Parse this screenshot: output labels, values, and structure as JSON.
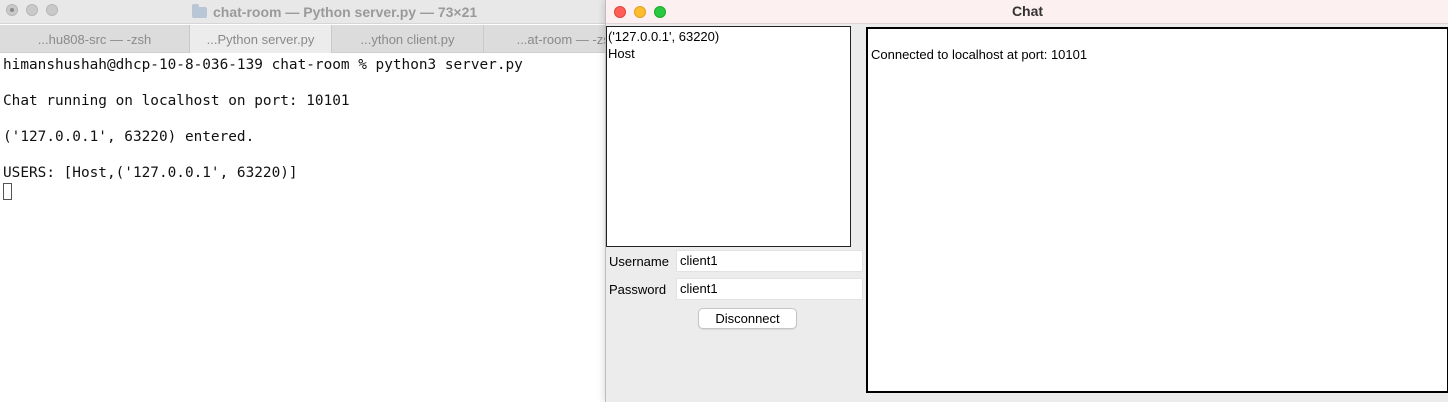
{
  "terminal": {
    "title": "chat-room — Python server.py — 73×21",
    "tabs": [
      {
        "label": "...hu808-src — -zsh",
        "active": false
      },
      {
        "label": "...Python server.py",
        "active": true
      },
      {
        "label": "...ython client.py",
        "active": false
      },
      {
        "label": "...at-room — -zsh",
        "active": false
      }
    ],
    "lines": [
      "himanshushah@dhcp-10-8-036-139 chat-room % python3 server.py",
      "",
      "Chat running on localhost on port: 10101",
      "",
      "('127.0.0.1', 63220) entered.",
      "",
      "USERS: [Host,('127.0.0.1', 63220)]"
    ]
  },
  "chat": {
    "title": "Chat",
    "users": [
      "('127.0.0.1', 63220)",
      "Host"
    ],
    "username_label": "Username",
    "username_value": "client1",
    "password_label": "Password",
    "password_value": "client1",
    "disconnect_label": "Disconnect",
    "messages": [
      "Connected to localhost at port: 10101"
    ]
  },
  "colors": {
    "close": "#ff5f57",
    "minimize": "#febc2e",
    "zoom": "#28c840"
  }
}
